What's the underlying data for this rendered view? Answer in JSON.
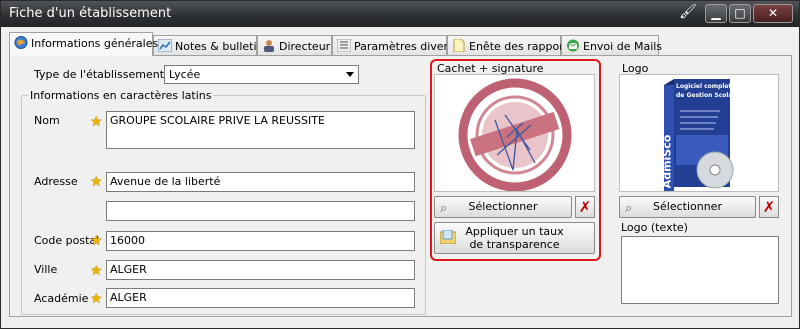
{
  "window": {
    "title": "Fiche d'un établissement",
    "controls": {
      "minimize": "▁",
      "maximize": "□",
      "close": "✕"
    }
  },
  "tabs": [
    {
      "label": "Informations générales",
      "icon": "globe-icon",
      "active": true
    },
    {
      "label": "Notes & bulletins",
      "icon": "chart-icon"
    },
    {
      "label": "Directeur",
      "icon": "person-icon"
    },
    {
      "label": "Paramètres divers",
      "icon": "list-icon"
    },
    {
      "label": "Enête des rapports",
      "icon": "document-icon"
    },
    {
      "label": "Envoi de Mails",
      "icon": "mail-icon"
    }
  ],
  "general": {
    "type_label": "Type de l'établissement",
    "type_value": "Lycée",
    "latin_group_title": "Informations en caractères latins",
    "fields": {
      "nom_label": "Nom",
      "nom_value": "GROUPE SCOLAIRE PRIVE LA REUSSITE",
      "adresse_label": "Adresse",
      "adresse_value": "Avenue de la liberté",
      "adresse2_value": "",
      "code_postal_label": "Code postal",
      "code_postal_value": "16000",
      "ville_label": "Ville",
      "ville_value": "ALGER",
      "academie_label": "Académie",
      "academie_value": "ALGER"
    }
  },
  "stamp": {
    "title": "Cachet + signature",
    "select_label": "Sélectionner",
    "transparency_label_1": "Appliquer un taux",
    "transparency_label_2": "de transparence"
  },
  "logo": {
    "title": "Logo",
    "select_label": "Sélectionner",
    "text_label": "Logo (texte)",
    "text_value": "",
    "box_text_1": "Logiciel complet",
    "box_text_2": "de Gestion Scolaire",
    "box_brand": "AdmiSco"
  },
  "colors": {
    "highlight": "#e0161b",
    "star": "#e8b400",
    "stamp": "#b3465a"
  }
}
